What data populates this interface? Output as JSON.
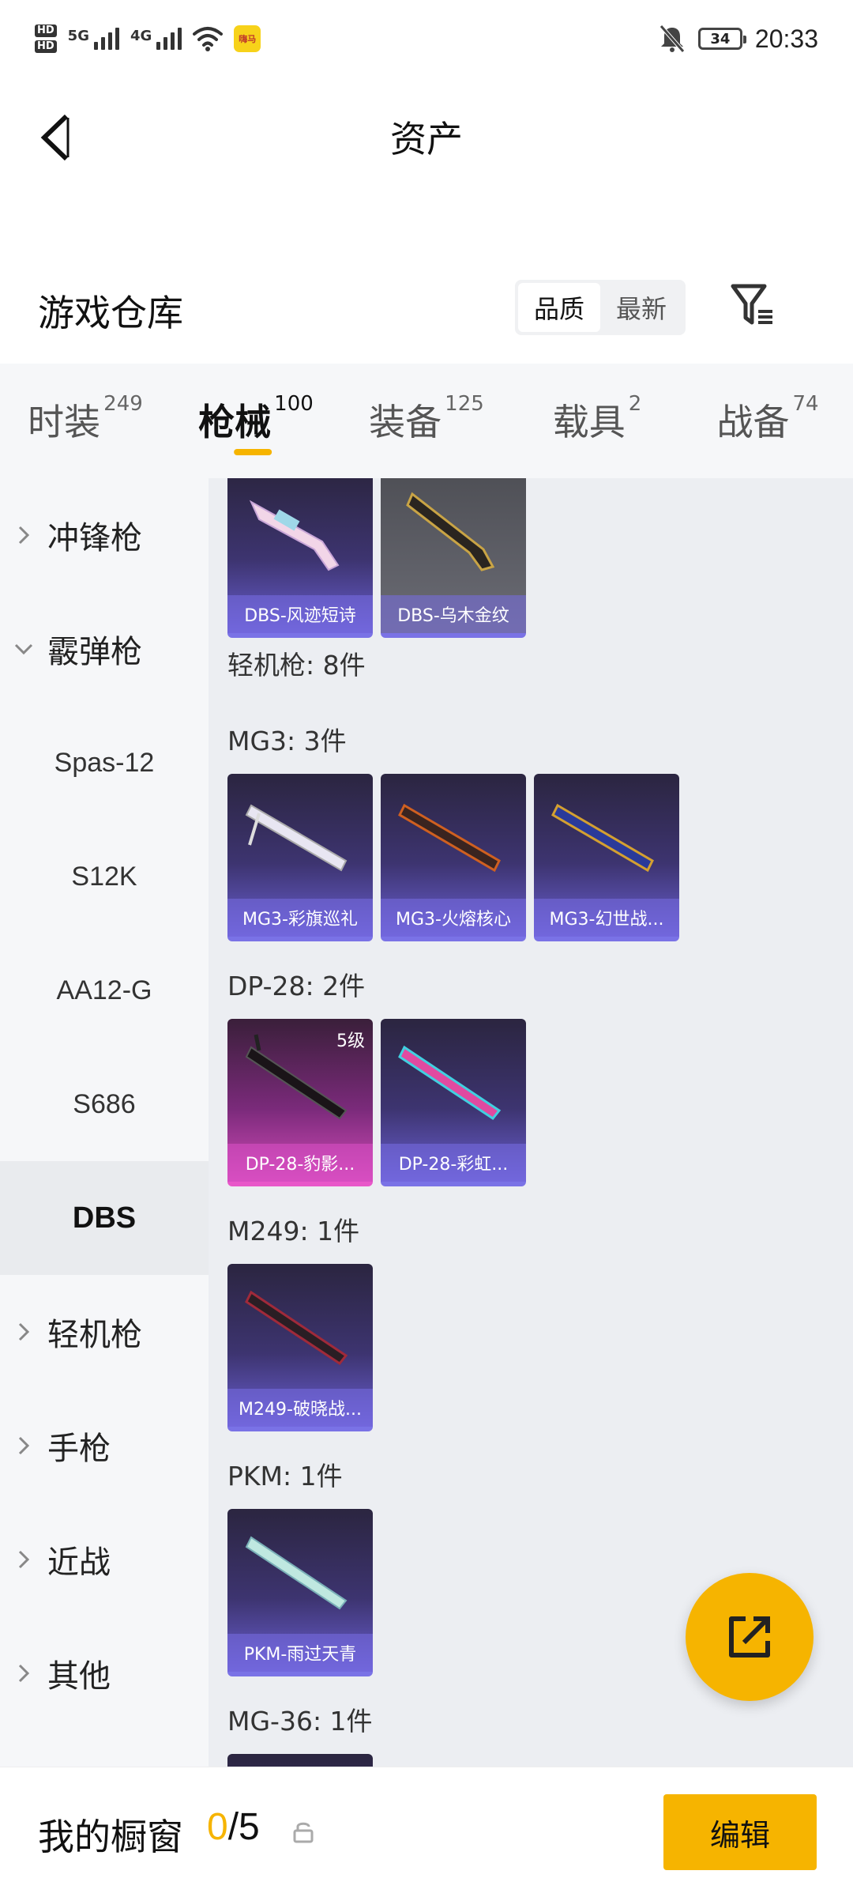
{
  "status_bar": {
    "hd_tags": [
      "HD",
      "HD"
    ],
    "net_labels": [
      "5G",
      "4G"
    ],
    "app_badge": "嗨马",
    "battery": "34",
    "time": "20:33"
  },
  "header": {
    "title": "资产"
  },
  "section": {
    "title": "游戏仓库",
    "sort_options": [
      "品质",
      "最新"
    ],
    "active_sort": "品质"
  },
  "tabs": [
    {
      "label": "时装",
      "count": "249"
    },
    {
      "label": "枪械",
      "count": "100",
      "active": true
    },
    {
      "label": "装备",
      "count": "125"
    },
    {
      "label": "载具",
      "count": "2"
    },
    {
      "label": "战备",
      "count": "74"
    }
  ],
  "sidebar": {
    "items": [
      {
        "label": "冲锋枪",
        "kind": "parent",
        "expanded": false
      },
      {
        "label": "霰弹枪",
        "kind": "parent",
        "expanded": true
      },
      {
        "label": "Spas-12",
        "kind": "sub"
      },
      {
        "label": "S12K",
        "kind": "sub"
      },
      {
        "label": "AA12-G",
        "kind": "sub"
      },
      {
        "label": "S686",
        "kind": "sub"
      },
      {
        "label": "DBS",
        "kind": "sub",
        "selected": true
      },
      {
        "label": "轻机枪",
        "kind": "parent",
        "expanded": false
      },
      {
        "label": "手枪",
        "kind": "parent",
        "expanded": false
      },
      {
        "label": "近战",
        "kind": "parent",
        "expanded": false
      },
      {
        "label": "其他",
        "kind": "parent",
        "expanded": false
      }
    ]
  },
  "grid": {
    "dbs_cards": [
      {
        "name": "DBS-风迹短诗",
        "style": "purple"
      },
      {
        "name": "DBS-乌木金纹",
        "style": "gray"
      }
    ],
    "groups": [
      {
        "title": "轻机枪: 8件",
        "cards": []
      },
      {
        "title": "MG3: 3件",
        "cards": [
          {
            "name": "MG3-彩旗巡礼",
            "style": "purple"
          },
          {
            "name": "MG3-火熔核心",
            "style": "purple"
          },
          {
            "name": "MG3-幻世战...",
            "style": "purple"
          }
        ]
      },
      {
        "title": "DP-28: 2件",
        "cards": [
          {
            "name": "DP-28-豹影...",
            "style": "pink",
            "level": "5级"
          },
          {
            "name": "DP-28-彩虹...",
            "style": "purple"
          }
        ]
      },
      {
        "title": "M249: 1件",
        "cards": [
          {
            "name": "M249-破晓战...",
            "style": "purple"
          }
        ]
      },
      {
        "title": "PKM: 1件",
        "cards": [
          {
            "name": "PKM-雨过天青",
            "style": "purple"
          }
        ]
      },
      {
        "title": "MG-36: 1件",
        "cards": []
      }
    ]
  },
  "bottom_bar": {
    "label": "我的橱窗",
    "current": "0",
    "separator": "/",
    "total": "5",
    "edit_label": "编辑"
  },
  "colors": {
    "accent": "#f6b400",
    "card_purple": "#6a5fd2",
    "card_pink": "#d24bb8"
  }
}
